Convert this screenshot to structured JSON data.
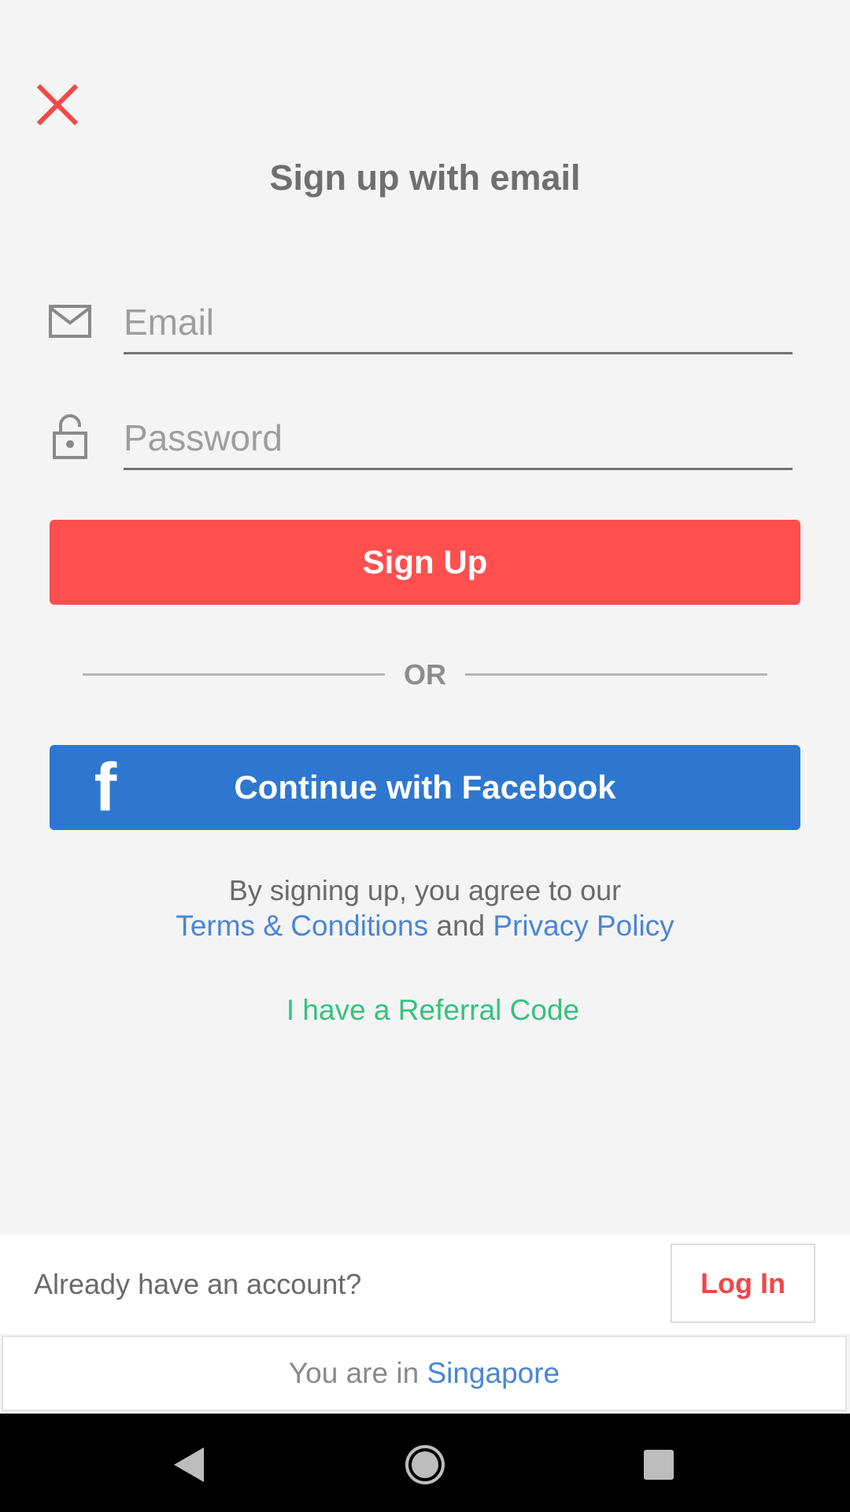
{
  "header": {
    "title": "Sign up with email"
  },
  "form": {
    "email_placeholder": "Email",
    "password_placeholder": "Password",
    "signup_label": "Sign Up"
  },
  "divider": {
    "label": "OR"
  },
  "facebook": {
    "label": "Continue with Facebook",
    "icon": "f"
  },
  "legal": {
    "agree_text": "By signing up, you agree to our",
    "terms": "Terms & Conditions",
    "and": "and",
    "privacy": "Privacy Policy"
  },
  "referral": {
    "label": "I have a Referral Code"
  },
  "account": {
    "prompt": "Already have an account?",
    "login_label": "Log In"
  },
  "location": {
    "prefix": "You are in",
    "country": "Singapore"
  },
  "colors": {
    "primary_red": "#ff4f4f",
    "facebook_blue": "#2e77d0",
    "link_blue": "#4a86d6",
    "referral_green": "#36c27c"
  }
}
